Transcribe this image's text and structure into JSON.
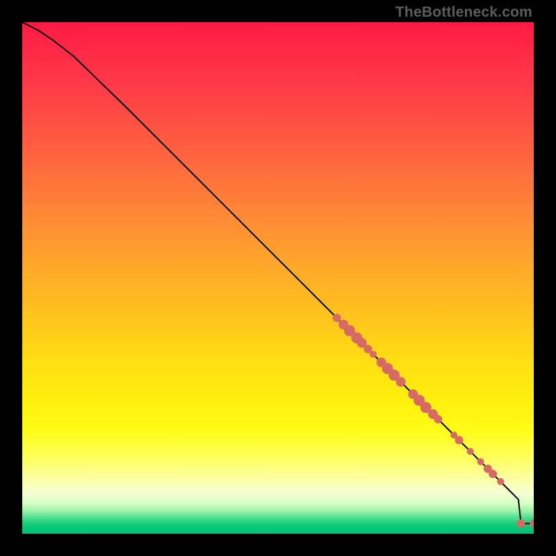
{
  "watermark": "TheBottleneck.com",
  "chart_data": {
    "type": "line",
    "title": "",
    "xlabel": "",
    "ylabel": "",
    "xlim": [
      0,
      100
    ],
    "ylim": [
      0,
      100
    ],
    "curve": {
      "name": "bottleneck-curve",
      "points_xy": [
        [
          0,
          100
        ],
        [
          3,
          98.5
        ],
        [
          6,
          96.5
        ],
        [
          10,
          93.4
        ],
        [
          20,
          83.7
        ],
        [
          30,
          73.7
        ],
        [
          40,
          63.7
        ],
        [
          50,
          53.7
        ],
        [
          60,
          43.7
        ],
        [
          70,
          33.7
        ],
        [
          80,
          23.7
        ],
        [
          90,
          13.7
        ],
        [
          95,
          8.7
        ],
        [
          97,
          6.7
        ],
        [
          97.5,
          2.0
        ],
        [
          100,
          2.0
        ]
      ]
    },
    "scatter": {
      "name": "highlighted-segment",
      "color": "#d86a65",
      "points_xy_r": [
        [
          61.5,
          42.2,
          6
        ],
        [
          62.8,
          40.9,
          7
        ],
        [
          64.0,
          39.7,
          8
        ],
        [
          65.4,
          38.3,
          8
        ],
        [
          66.4,
          37.3,
          7
        ],
        [
          67.6,
          36.1,
          6
        ],
        [
          68.6,
          35.1,
          5
        ],
        [
          70.2,
          33.5,
          7
        ],
        [
          71.4,
          32.3,
          8
        ],
        [
          72.7,
          31.0,
          8
        ],
        [
          74.0,
          29.7,
          7
        ],
        [
          76.4,
          27.3,
          7
        ],
        [
          77.6,
          26.1,
          8
        ],
        [
          78.9,
          24.7,
          8
        ],
        [
          80.3,
          23.4,
          7
        ],
        [
          81.3,
          22.4,
          6
        ],
        [
          84.4,
          19.3,
          5
        ],
        [
          85.4,
          18.3,
          6
        ],
        [
          87.6,
          16.1,
          5
        ],
        [
          89.6,
          14.1,
          5
        ],
        [
          91.0,
          12.7,
          6
        ],
        [
          92.0,
          11.7,
          6
        ],
        [
          93.5,
          10.2,
          5
        ],
        [
          97.5,
          2.0,
          6
        ],
        [
          100.0,
          2.0,
          6
        ]
      ]
    }
  }
}
